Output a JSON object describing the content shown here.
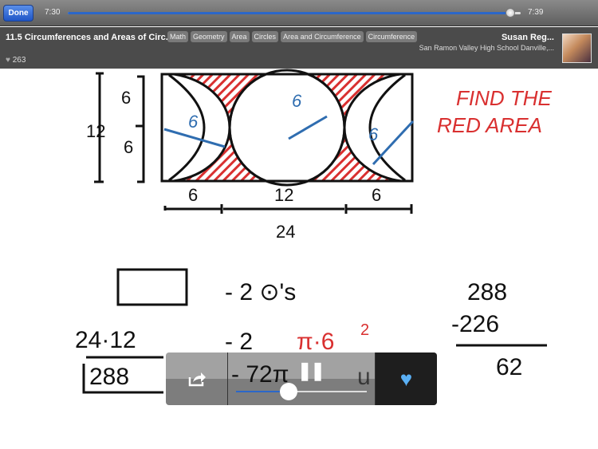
{
  "topbar": {
    "done_label": "Done",
    "elapsed": "7:30",
    "total": "7:39",
    "progress_percent": 98
  },
  "info": {
    "title": "11.5 Circumferences and Areas of Circ...",
    "tags": [
      "Math",
      "Geometry",
      "Area",
      "Circles",
      "Area and Circumference",
      "Circumference"
    ],
    "author": "Susan Reg...",
    "school": "San Ramon Valley High School  Danville,...",
    "likes": "263"
  },
  "board": {
    "heading1": "FIND THE",
    "heading2": "RED AREA",
    "dims": {
      "six": "6",
      "twelve": "12",
      "twentyfour": "24"
    },
    "eq": {
      "line1_right": "- 2 ⊙'s",
      "line2_left": "24·12",
      "line2_mid": "- 2",
      "line2_pi": "π·6",
      "line2_sq": "2",
      "line3_left": "288",
      "line3_mid": "- 72π",
      "line3_tail": "u",
      "sub_top": "288",
      "sub_mid": "-226",
      "sub_res": "62"
    }
  },
  "controls": {
    "volume_percent": 40,
    "share_icon": "share-icon",
    "pause_icon": "pause-icon",
    "heart_icon": "heart-icon",
    "heart_color": "#5ab0f5"
  },
  "colors": {
    "red": "#d93030",
    "blue": "#2f6db0",
    "accent": "#2b67c9"
  }
}
